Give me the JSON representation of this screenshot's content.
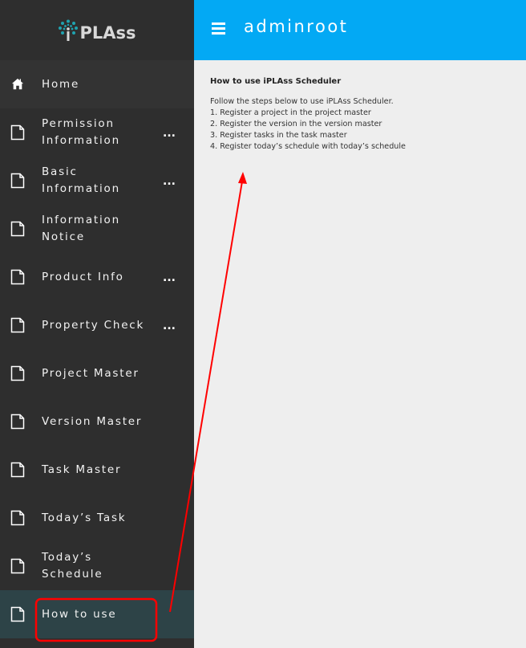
{
  "sidebar": {
    "logo_text": "PLAss",
    "logo_accent": "#1fa3b0",
    "items": [
      {
        "label": "Home",
        "icon": "home-icon",
        "has_more": false
      },
      {
        "label": "Permission Information",
        "icon": "document-icon",
        "has_more": true
      },
      {
        "label": "Basic Information",
        "icon": "document-icon",
        "has_more": true
      },
      {
        "label": "Information Notice",
        "icon": "document-icon",
        "has_more": false
      },
      {
        "label": "Product Info",
        "icon": "document-icon",
        "has_more": true
      },
      {
        "label": "Property Check",
        "icon": "document-icon",
        "has_more": true
      },
      {
        "label": "Project Master",
        "icon": "document-icon",
        "has_more": false
      },
      {
        "label": "Version Master",
        "icon": "document-icon",
        "has_more": false
      },
      {
        "label": "Task Master",
        "icon": "document-icon",
        "has_more": false
      },
      {
        "label": "Today’s Task",
        "icon": "document-icon",
        "has_more": false
      },
      {
        "label": "Today’s Schedule",
        "icon": "document-icon",
        "has_more": false
      },
      {
        "label": "How to use",
        "icon": "document-icon",
        "has_more": false,
        "active": true
      }
    ],
    "more_label": "..."
  },
  "header": {
    "menu_icon": "hamburger-icon",
    "title": "adminroot",
    "color": "#03a9f4"
  },
  "main": {
    "heading": "How to use iPLAss Scheduler",
    "lines": [
      "Follow the steps below to use iPLAss Scheduler.",
      "1. Register a project in the project master",
      "2. Register the version in the version master",
      "3. Register tasks in the task master",
      "4. Register today’s schedule with today’s schedule"
    ]
  },
  "annotation": {
    "color": "#ff0000",
    "description": "Red box highlights 'How to use' menu item with arrow pointing to the content area"
  }
}
